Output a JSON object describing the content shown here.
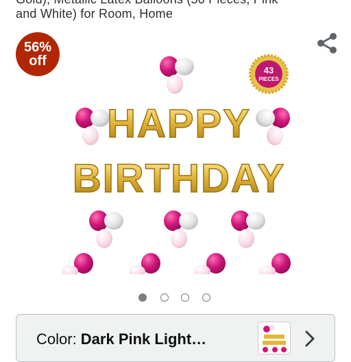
{
  "product": {
    "title_line1": "Gold), Metallic Latex Balloons (50 Pieces, Pink",
    "title_line2": "and White) for Room, Home"
  },
  "discount": {
    "percent": "56%",
    "off": "off",
    "color": "#b12704"
  },
  "image": {
    "banner_line1": "HAPPY",
    "banner_line2": "BIRTHDAY",
    "pieces_count": "43",
    "pieces_label": "PIECES"
  },
  "carousel": {
    "total": 4,
    "active_index": 0
  },
  "color_option": {
    "label": "Color: ",
    "value": "Dark Pink Light…"
  },
  "icons": [
    "share-icon",
    "chevron-right-icon"
  ],
  "colors": {
    "gold": "#e3b63a",
    "pink": "#d0167a",
    "silver": "#e6e6e6"
  }
}
